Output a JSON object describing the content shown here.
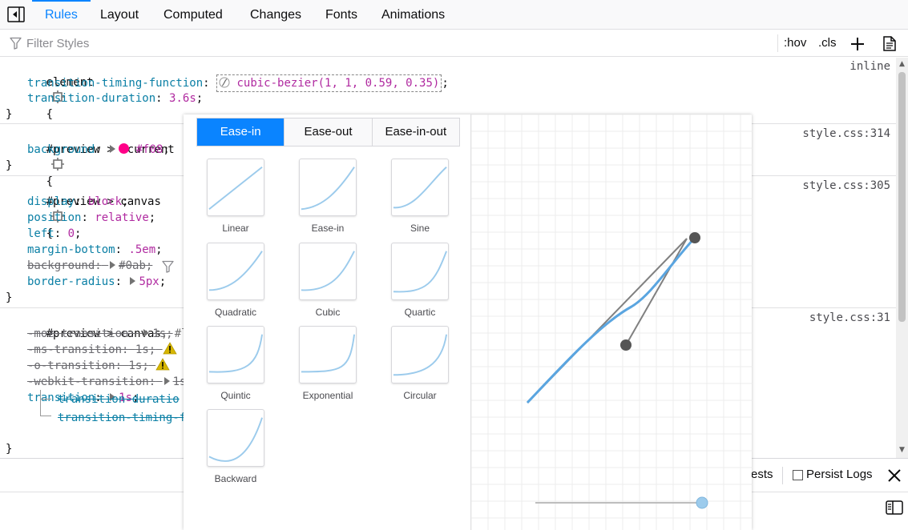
{
  "tabs": [
    {
      "label": "Rules",
      "selected": true
    },
    {
      "label": "Layout"
    },
    {
      "label": "Computed"
    },
    {
      "label": "Changes"
    },
    {
      "label": "Fonts"
    },
    {
      "label": "Animations"
    }
  ],
  "filter": {
    "placeholder": "Filter Styles"
  },
  "toolbar": {
    "hov": ":hov",
    "cls": ".cls"
  },
  "rules": {
    "r1": {
      "selector": "element",
      "source": "inline",
      "p1": {
        "name": "transition-timing-function",
        "value": "cubic-bezier(1, 1, 0.59, 0.35)"
      },
      "p2": {
        "name": "transition-duration",
        "value": "3.6s"
      }
    },
    "r2": {
      "selector": "#preview > #current",
      "source": "style.css:314",
      "p1": {
        "name": "background",
        "value": "#f08",
        "swatch": "#ff0088"
      }
    },
    "r3": {
      "selector": "#preview > canvas",
      "source": "style.css:305",
      "p1": {
        "name": "display",
        "value": "block"
      },
      "p2": {
        "name": "position",
        "value": "relative"
      },
      "p3": {
        "name": "left",
        "value": "0"
      },
      "p4": {
        "name": "margin-bottom",
        "value": ".5em"
      },
      "p5": {
        "name": "background",
        "value": "#0ab"
      },
      "p6": {
        "name": "border-radius",
        "value": "5px"
      }
    },
    "r4": {
      "selector": "#preview > canvas",
      "selector_rest": ", #library",
      "source": "style.css:31",
      "p1": {
        "name": "-moz-transition",
        "value": "1s"
      },
      "p2": {
        "name": "-ms-transition",
        "value": "1s"
      },
      "p3": {
        "name": "-o-transition",
        "value": "1s"
      },
      "p4": {
        "name": "-webkit-transition",
        "value": "1s"
      },
      "p5": {
        "name": "transition",
        "value": "1s"
      },
      "sub1": "transition-duratio",
      "sub2": "transition-timing-f"
    },
    "colon": ":",
    "semi": ";",
    "open": "{",
    "close": "}"
  },
  "console": {
    "requests": "ests",
    "persist_logs": "Persist Logs"
  },
  "popup": {
    "tabs": [
      "Ease-in",
      "Ease-out",
      "Ease-in-out"
    ],
    "active_tab": "Ease-in",
    "presets": [
      "Linear",
      "Ease-in",
      "Sine",
      "Quadratic",
      "Cubic",
      "Quartic",
      "Quintic",
      "Exponential",
      "Circular",
      "Backward"
    ],
    "slider_value": 1.0
  },
  "colors": {
    "accent": "#0a84ff",
    "curve": "#5aa5e0",
    "handle": "#555555"
  }
}
